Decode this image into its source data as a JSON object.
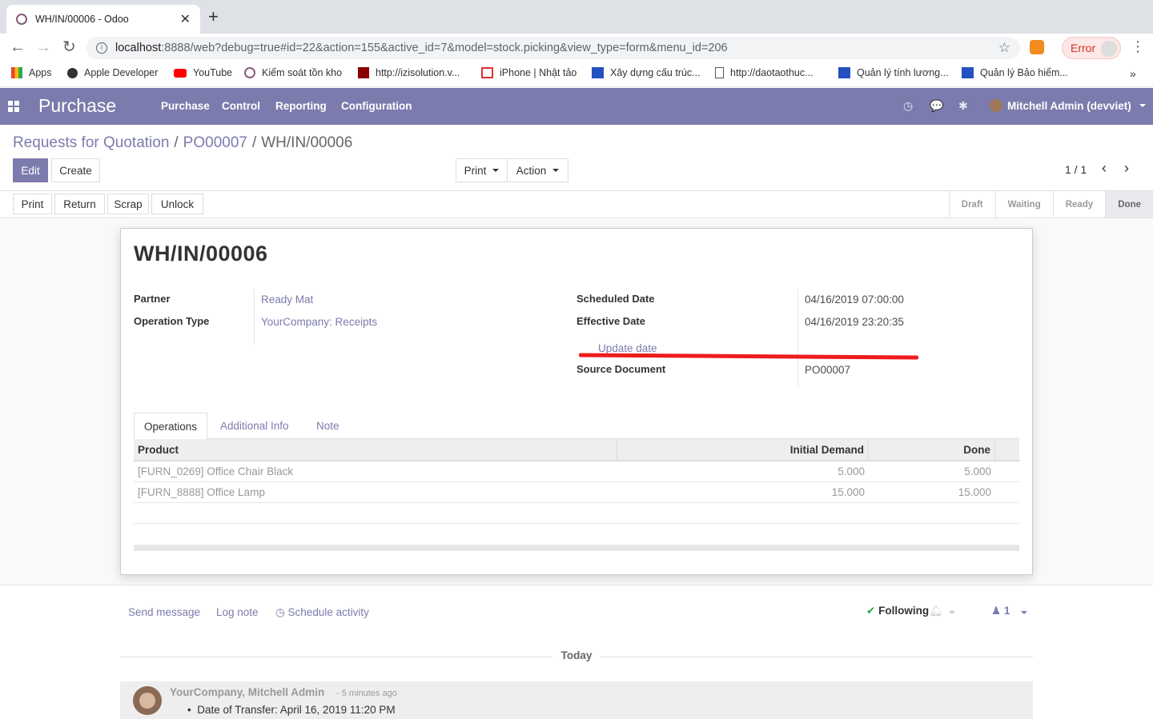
{
  "browser": {
    "tab_title": "WH/IN/00006 - Odoo",
    "url_host": "localhost",
    "url_rest": ":8888/web?debug=true#id=22&action=155&active_id=7&model=stock.picking&view_type=form&menu_id=206",
    "error_label": "Error",
    "bookmarks": [
      "Apps",
      "Apple Developer",
      "YouTube",
      "Kiểm soát tồn kho",
      "http://izisolution.v...",
      "iPhone | Nhật tảo",
      "Xây dựng cấu trúc...",
      "http://daotaothuc...",
      "Quản lý tính lương...",
      "Quản lý Bảo hiểm..."
    ]
  },
  "nav": {
    "brand": "Purchase",
    "menus": [
      "Purchase",
      "Control",
      "Reporting",
      "Configuration"
    ],
    "user": "Mitchell Admin (devviet)"
  },
  "control": {
    "breadcrumb": [
      "Requests for Quotation",
      "PO00007",
      "WH/IN/00006"
    ],
    "edit": "Edit",
    "create": "Create",
    "print": "Print",
    "action": "Action",
    "pager": "1 / 1"
  },
  "statusbar": {
    "buttons": [
      "Print",
      "Return",
      "Scrap",
      "Unlock"
    ],
    "stages": [
      "Draft",
      "Waiting",
      "Ready",
      "Done"
    ],
    "current_stage": "Done"
  },
  "record": {
    "name": "WH/IN/00006",
    "partner_label": "Partner",
    "partner": "Ready Mat",
    "operation_type_label": "Operation Type",
    "operation_type": "YourCompany: Receipts",
    "scheduled_date_label": "Scheduled Date",
    "scheduled_date": "04/16/2019 07:00:00",
    "effective_date_label": "Effective Date",
    "effective_date": "04/16/2019 23:20:35",
    "update_date": "Update date",
    "source_document_label": "Source Document",
    "source_document": "PO00007"
  },
  "notebook": {
    "tabs": [
      "Operations",
      "Additional Info",
      "Note"
    ],
    "columns": [
      "Product",
      "Initial Demand",
      "Done"
    ],
    "rows": [
      {
        "product": "[FURN_0269] Office Chair Black",
        "demand": "5.000",
        "done": "5.000"
      },
      {
        "product": "[FURN_8888] Office Lamp",
        "demand": "15.000",
        "done": "15.000"
      }
    ]
  },
  "chatter": {
    "send_message": "Send message",
    "log_note": "Log note",
    "schedule_activity": "Schedule activity",
    "following": "Following",
    "followers_count": "1",
    "today": "Today",
    "author": "YourCompany, Mitchell Admin",
    "ago": "- 5 minutes ago",
    "bullet": "Date of Transfer: April 16, 2019 11:20 PM"
  }
}
